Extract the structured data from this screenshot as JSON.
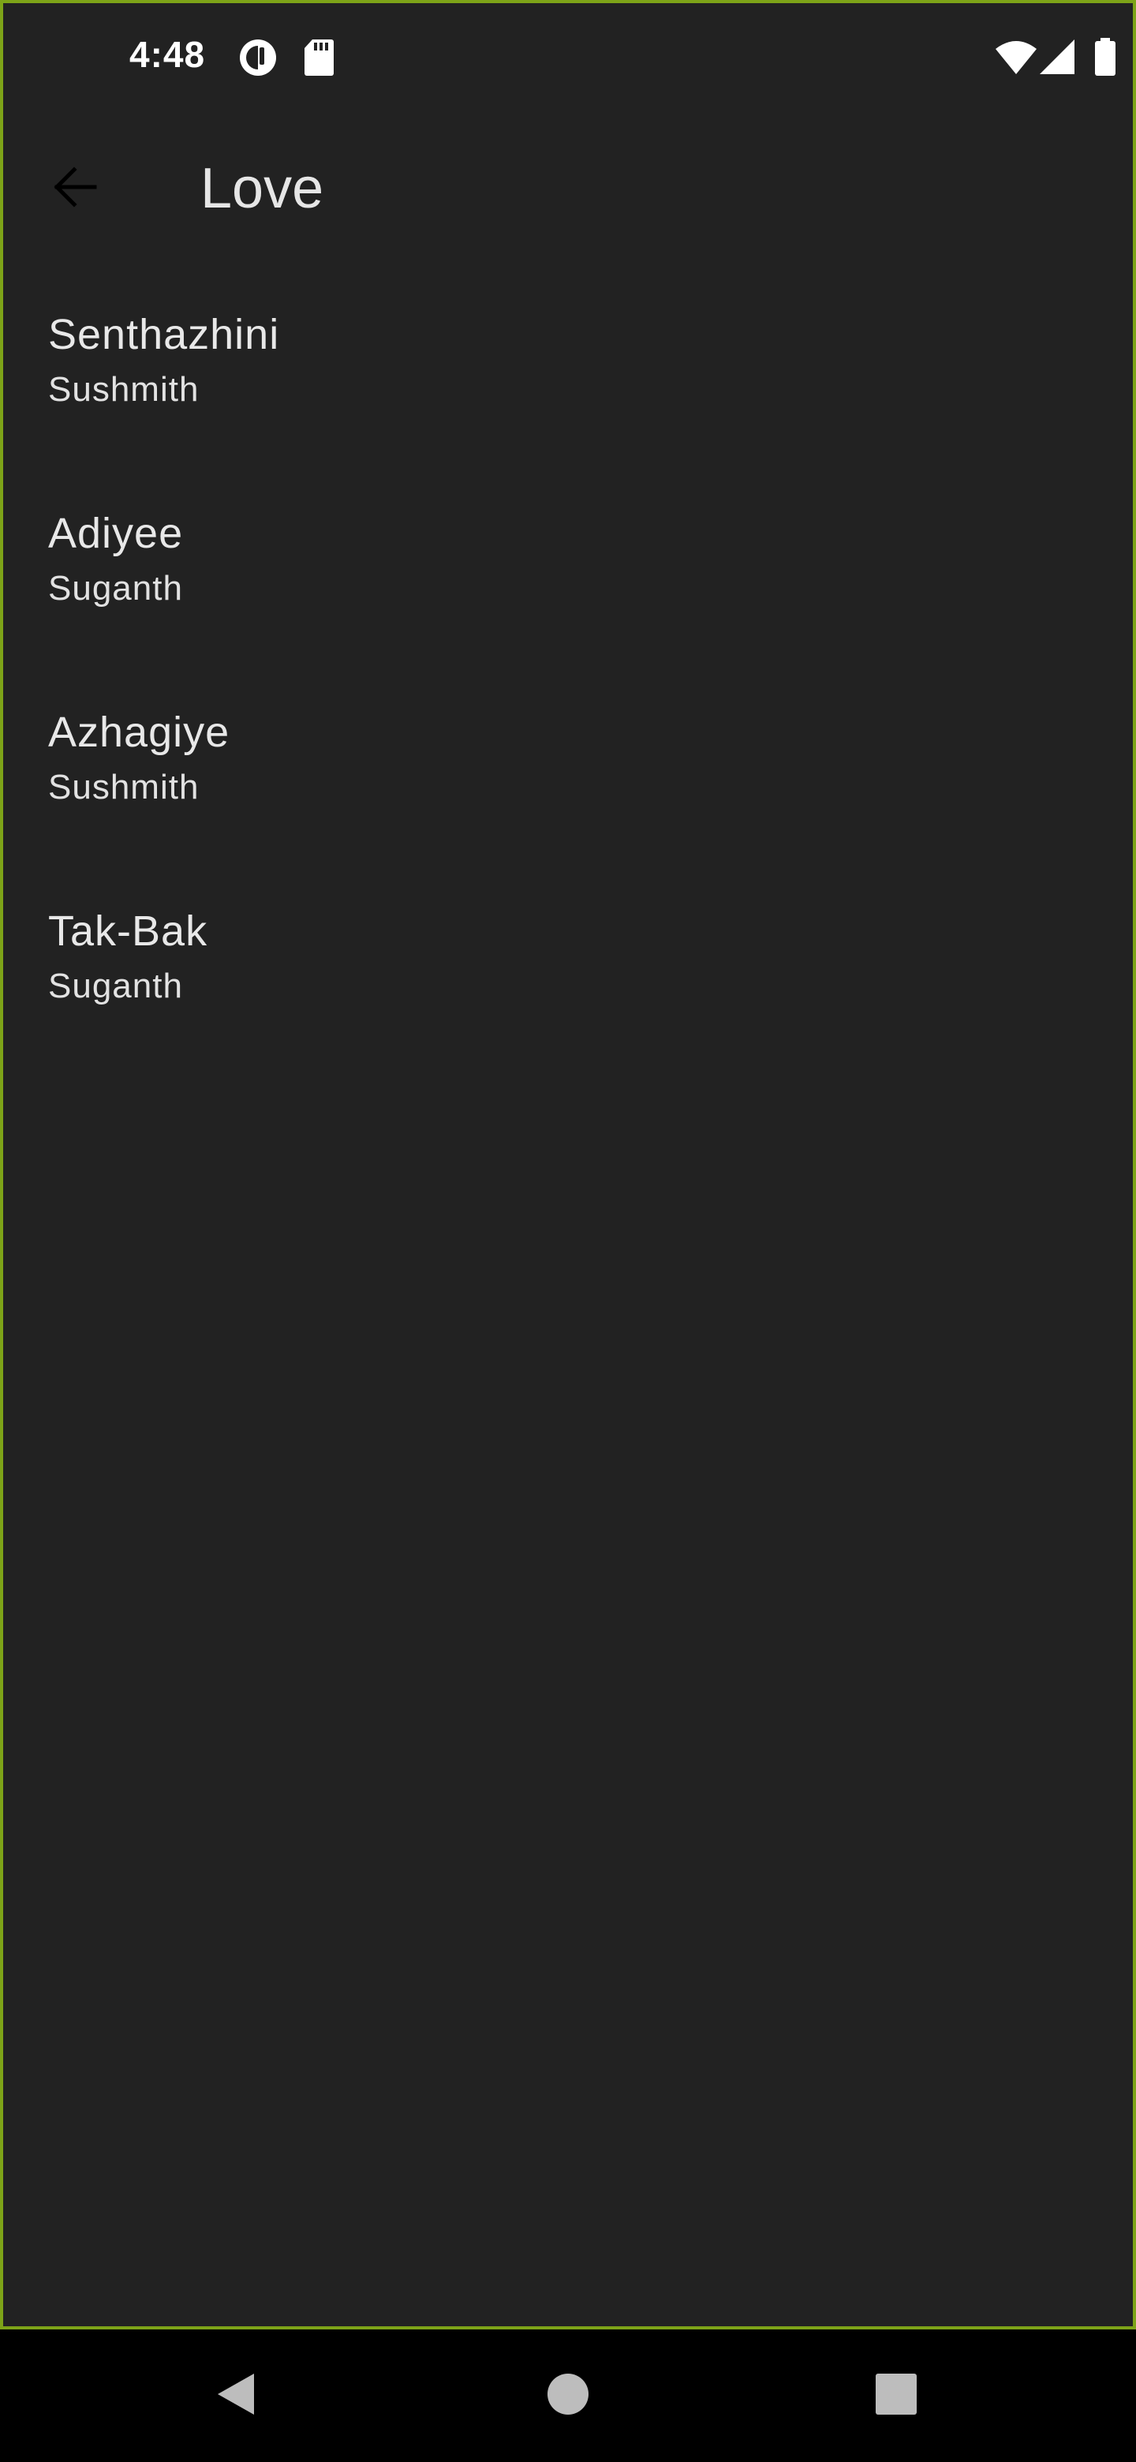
{
  "status_bar": {
    "time": "4:48",
    "icons": [
      "data-saver-icon",
      "sd-card-icon",
      "wifi-icon",
      "cellular-signal-icon",
      "battery-icon"
    ]
  },
  "app_bar": {
    "title": "Love",
    "back_icon": "arrow-back-icon"
  },
  "songs": [
    {
      "title": "Senthazhini",
      "artist": "Sushmith"
    },
    {
      "title": "Adiyee",
      "artist": "Suganth"
    },
    {
      "title": "Azhagiye",
      "artist": "Sushmith"
    },
    {
      "title": "Tak-Bak",
      "artist": "Suganth"
    }
  ],
  "nav_bar": {
    "icons": [
      "back-triangle-icon",
      "home-circle-icon",
      "recents-square-icon"
    ]
  },
  "colors": {
    "background": "#222222",
    "frame_border": "#7da318",
    "text_primary": "#e8e8e8",
    "nav_background": "#000000"
  }
}
